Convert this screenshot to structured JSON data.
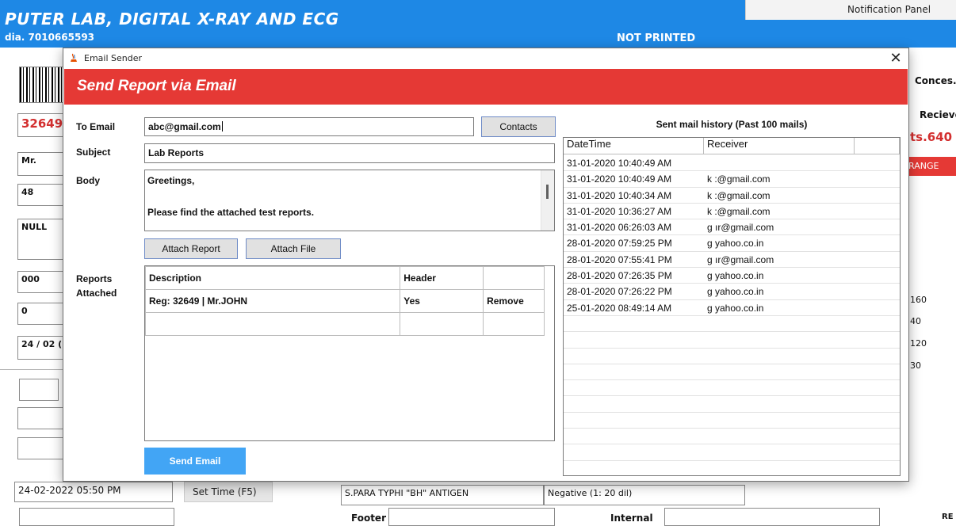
{
  "background_app": {
    "header_title": "PUTER LAB, DIGITAL X-RAY AND ECG",
    "header_phone": "dia. 7010665593",
    "print_status": "NOT PRINTED",
    "notification_panel": "Notification Panel",
    "left_fields": [
      "32649",
      "Mr.",
      "48",
      "NULL",
      "000",
      "0",
      "24 / 02 ("
    ],
    "right_labels": {
      "conces": "Conces.",
      "recieve": "Recieve",
      "amount": "ts.640",
      "range": "RANGE"
    },
    "right_values": [
      "160",
      "40",
      "120",
      "30"
    ],
    "datetime": "24-02-2022 05:50 PM",
    "set_time_button": "Set Time (F5)",
    "test_name": "S.PARA TYPHI \"BH\" ANTIGEN",
    "test_result": "Negative  (1: 20 dil)",
    "footer_label": "Footer",
    "internal_label": "Internal",
    "re_label": "RE"
  },
  "dialog": {
    "window_title": "Email Sender",
    "close_glyph": "✕",
    "banner_title": "Send Report via Email",
    "to_email": {
      "label": "To Email",
      "value": "abc@gmail.com"
    },
    "contacts_button": "Contacts",
    "subject": {
      "label": "Subject",
      "value": "Lab Reports"
    },
    "body": {
      "label": "Body",
      "line1": "Greetings,",
      "line2": "Please find the attached test reports."
    },
    "attach_report_button": "Attach Report",
    "attach_file_button": "Attach File",
    "reports_label_line1": "Reports",
    "reports_label_line2": "Attached",
    "reports_table": {
      "headers": [
        "Description",
        "Header",
        ""
      ],
      "rows": [
        {
          "description": "Reg: 32649 | Mr.JOHN",
          "header": "Yes",
          "action": "Remove"
        }
      ]
    },
    "send_button": "Send Email",
    "history": {
      "title": "Sent mail history (Past 100 mails)",
      "headers": [
        "DateTime",
        "Receiver",
        ""
      ],
      "rows": [
        {
          "datetime": "31-01-2020 10:40:49 AM",
          "receiver": ""
        },
        {
          "datetime": "31-01-2020 10:40:49 AM",
          "receiver": "k          :@gmail.com"
        },
        {
          "datetime": "31-01-2020 10:40:34 AM",
          "receiver": "k          :@gmail.com"
        },
        {
          "datetime": "31-01-2020 10:36:27 AM",
          "receiver": "k          :@gmail.com"
        },
        {
          "datetime": "31-01-2020 06:26:03 AM",
          "receiver": "g         ır@gmail.com"
        },
        {
          "datetime": "28-01-2020 07:59:25 PM",
          "receiver": "g         yahoo.co.in"
        },
        {
          "datetime": "28-01-2020 07:55:41 PM",
          "receiver": "g         ır@gmail.com"
        },
        {
          "datetime": "28-01-2020 07:26:35 PM",
          "receiver": "g         yahoo.co.in"
        },
        {
          "datetime": "28-01-2020 07:26:22 PM",
          "receiver": "g         yahoo.co.in"
        },
        {
          "datetime": "25-01-2020 08:49:14 AM",
          "receiver": "g         yahoo.co.in"
        }
      ]
    }
  },
  "colors": {
    "header_blue": "#1e88e5",
    "banner_red": "#e53935",
    "send_button_blue": "#42a5f5",
    "background_alert_red": "#d32f2f"
  }
}
